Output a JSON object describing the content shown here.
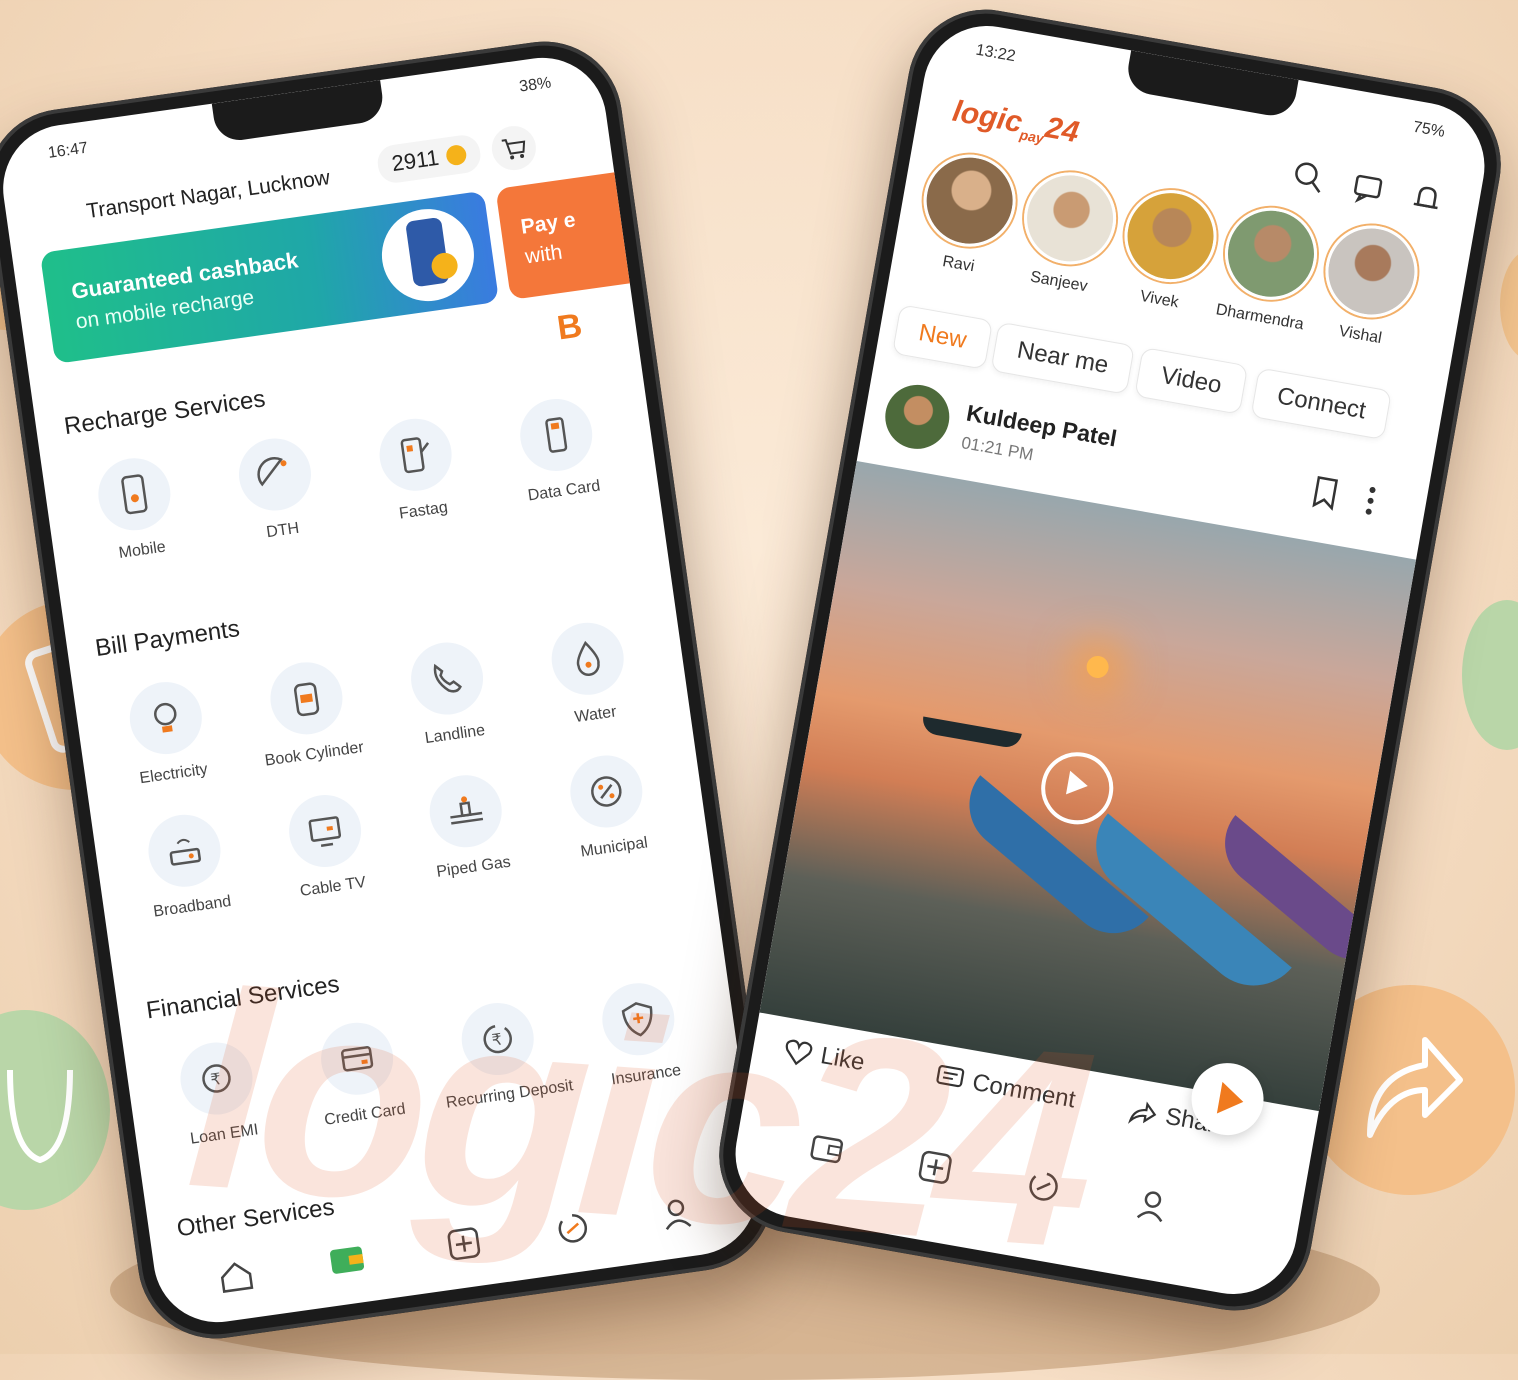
{
  "left_phone": {
    "status": {
      "time": "16:47",
      "battery": "38%"
    },
    "header": {
      "location": "Transport Nagar, Lucknow",
      "coins": "2911"
    },
    "banner": {
      "title": "Guaranteed cashback",
      "subtitle": "on mobile recharge",
      "side_line1": "Pay e",
      "side_line2": "with"
    },
    "badge": "B",
    "recharge": {
      "title": "Recharge Services",
      "items": [
        {
          "label": "Mobile",
          "icon": "mobile-icon"
        },
        {
          "label": "DTH",
          "icon": "dish-icon"
        },
        {
          "label": "Fastag",
          "icon": "fastag-icon"
        },
        {
          "label": "Data Card",
          "icon": "datacard-icon"
        }
      ]
    },
    "bills": {
      "title": "Bill Payments",
      "items": [
        {
          "label": "Electricity",
          "icon": "bulb-icon"
        },
        {
          "label": "Book Cylinder",
          "icon": "cylinder-icon"
        },
        {
          "label": "Landline",
          "icon": "phone-icon"
        },
        {
          "label": "Water",
          "icon": "drop-icon"
        },
        {
          "label": "Broadband",
          "icon": "router-icon"
        },
        {
          "label": "Cable TV",
          "icon": "tv-icon"
        },
        {
          "label": "Piped Gas",
          "icon": "pipe-icon"
        },
        {
          "label": "Municipal",
          "icon": "percent-icon"
        }
      ]
    },
    "financial": {
      "title": "Financial Services",
      "items": [
        {
          "label": "Loan EMI",
          "icon": "rupee-cycle-icon"
        },
        {
          "label": "Credit Card",
          "icon": "card-icon"
        },
        {
          "label": "Recurring Deposit",
          "icon": "deposit-icon"
        },
        {
          "label": "Insurance",
          "icon": "shield-icon"
        }
      ]
    },
    "other": {
      "title": "Other Services"
    }
  },
  "right_phone": {
    "status": {
      "time": "13:22",
      "battery": "75%"
    },
    "brand": {
      "name": "logic",
      "sub": "pay",
      "num": "24"
    },
    "stories": [
      {
        "name": "Ravi",
        "color": "#8a6a4a"
      },
      {
        "name": "Sanjeev",
        "color": "#b9a382"
      },
      {
        "name": "Vivek",
        "color": "#6b5a3d"
      },
      {
        "name": "Dharmendra",
        "color": "#9b8c72"
      },
      {
        "name": "Vishal",
        "color": "#8c7f78"
      }
    ],
    "tabs": [
      "New",
      "Near me",
      "Video",
      "Connect"
    ],
    "post": {
      "author": "Kuldeep Patel",
      "time": "01:21 PM"
    },
    "actions": {
      "like": "Like",
      "comment": "Comment",
      "share": "Share"
    }
  },
  "colors": {
    "accent": "#f07a1e",
    "green": "#1fbf8a",
    "blue": "#3a7be0"
  }
}
